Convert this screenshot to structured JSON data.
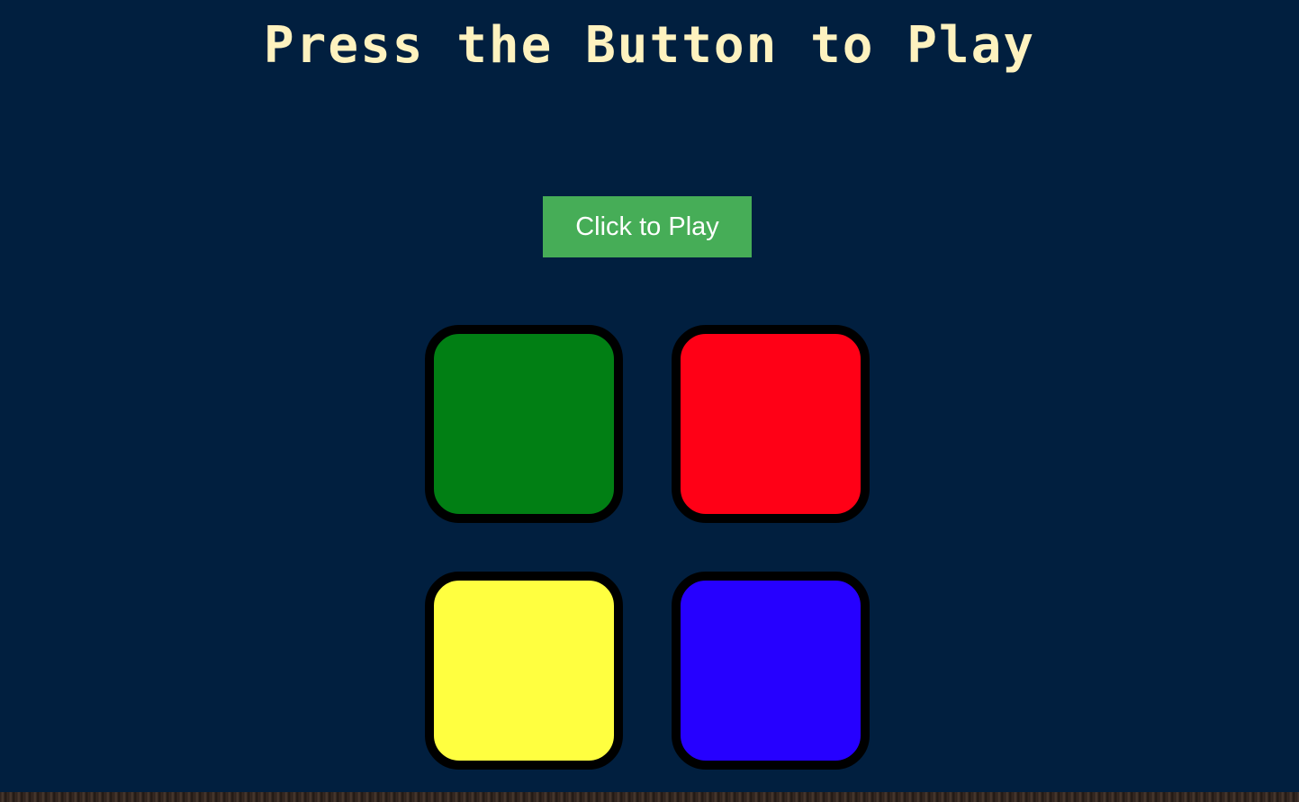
{
  "header": {
    "title": "Press the Button to Play"
  },
  "controls": {
    "play_label": "Click to Play",
    "play_color": "#46ad57"
  },
  "pads": [
    {
      "name": "green",
      "color": "#017f14"
    },
    {
      "name": "red",
      "color": "#ff0016"
    },
    {
      "name": "yellow",
      "color": "#ffff40"
    },
    {
      "name": "blue",
      "color": "#2600ff"
    }
  ],
  "theme": {
    "background": "#011f3f",
    "title_color": "#fef2bf",
    "pad_border": "#000000"
  }
}
